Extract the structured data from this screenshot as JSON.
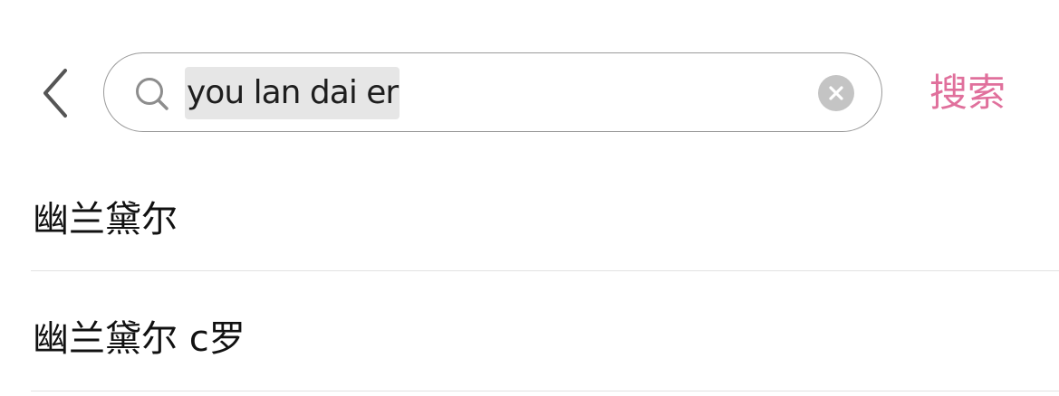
{
  "search": {
    "query": "you lan dai er",
    "submit_label": "搜索",
    "accent_color": "#e0709c"
  },
  "icons": {
    "back": "chevron-left-icon",
    "search": "search-icon",
    "clear": "clear-icon"
  },
  "suggestions": [
    {
      "label": "幽兰黛尔"
    },
    {
      "label": "幽兰黛尔 c罗"
    }
  ]
}
